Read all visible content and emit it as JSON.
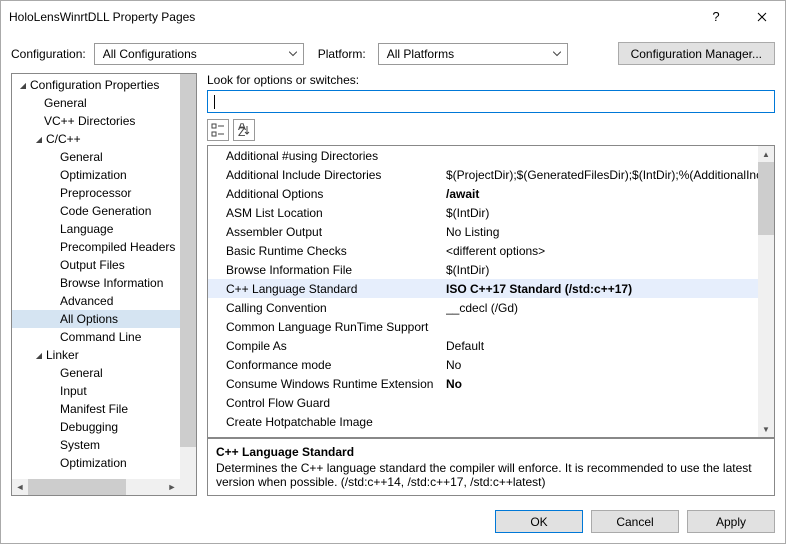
{
  "title": "HoloLensWinrtDLL Property Pages",
  "config_row": {
    "label_config": "Configuration:",
    "combo_config": "All Configurations",
    "label_platform": "Platform:",
    "combo_platform": "All Platforms",
    "btn_cfgmgr": "Configuration Manager..."
  },
  "tree": {
    "root": "Configuration Properties",
    "items": [
      {
        "label": "General",
        "indent": 1
      },
      {
        "label": "VC++ Directories",
        "indent": 1
      },
      {
        "label": "C/C++",
        "indent": 1,
        "exp": true
      },
      {
        "label": "General",
        "indent": 2
      },
      {
        "label": "Optimization",
        "indent": 2
      },
      {
        "label": "Preprocessor",
        "indent": 2
      },
      {
        "label": "Code Generation",
        "indent": 2
      },
      {
        "label": "Language",
        "indent": 2
      },
      {
        "label": "Precompiled Headers",
        "indent": 2
      },
      {
        "label": "Output Files",
        "indent": 2
      },
      {
        "label": "Browse Information",
        "indent": 2
      },
      {
        "label": "Advanced",
        "indent": 2
      },
      {
        "label": "All Options",
        "indent": 2,
        "selected": true
      },
      {
        "label": "Command Line",
        "indent": 2
      },
      {
        "label": "Linker",
        "indent": 1,
        "exp": true
      },
      {
        "label": "General",
        "indent": 2
      },
      {
        "label": "Input",
        "indent": 2
      },
      {
        "label": "Manifest File",
        "indent": 2
      },
      {
        "label": "Debugging",
        "indent": 2
      },
      {
        "label": "System",
        "indent": 2
      },
      {
        "label": "Optimization",
        "indent": 2
      }
    ]
  },
  "right": {
    "look_label": "Look for options or switches:",
    "grid": [
      {
        "name": "Additional #using Directories",
        "value": ""
      },
      {
        "name": "Additional Include Directories",
        "value": "$(ProjectDir);$(GeneratedFilesDir);$(IntDir);%(AdditionalIncludeDirectories)"
      },
      {
        "name": "Additional Options",
        "value": "/await",
        "bold": true
      },
      {
        "name": "ASM List Location",
        "value": "$(IntDir)"
      },
      {
        "name": "Assembler Output",
        "value": "No Listing"
      },
      {
        "name": "Basic Runtime Checks",
        "value": "<different options>"
      },
      {
        "name": "Browse Information File",
        "value": "$(IntDir)"
      },
      {
        "name": "C++ Language Standard",
        "value": "ISO C++17 Standard (/std:c++17)",
        "bold": true,
        "selected": true
      },
      {
        "name": "Calling Convention",
        "value": "__cdecl (/Gd)"
      },
      {
        "name": "Common Language RunTime Support",
        "value": ""
      },
      {
        "name": "Compile As",
        "value": "Default"
      },
      {
        "name": "Conformance mode",
        "value": "No"
      },
      {
        "name": "Consume Windows Runtime Extension",
        "value": "No",
        "bold": true
      },
      {
        "name": "Control Flow Guard",
        "value": ""
      },
      {
        "name": "Create Hotpatchable Image",
        "value": ""
      }
    ],
    "desc": {
      "title": "C++ Language Standard",
      "text": "Determines the C++ language standard the compiler will enforce. It is recommended to use the latest version when possible. (/std:c++14, /std:c++17, /std:c++latest)"
    }
  },
  "buttons": {
    "ok": "OK",
    "cancel": "Cancel",
    "apply": "Apply"
  }
}
